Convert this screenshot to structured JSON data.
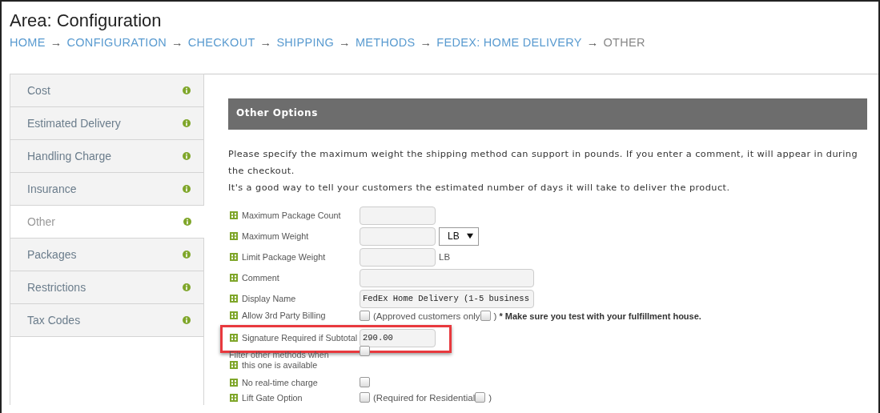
{
  "page": {
    "title": "Area: Configuration"
  },
  "breadcrumb": [
    {
      "label": "HOME",
      "current": false
    },
    {
      "label": "CONFIGURATION",
      "current": false
    },
    {
      "label": "CHECKOUT",
      "current": false
    },
    {
      "label": "SHIPPING",
      "current": false
    },
    {
      "label": "METHODS",
      "current": false
    },
    {
      "label": "FEDEX: HOME DELIVERY",
      "current": false
    },
    {
      "label": "OTHER",
      "current": true
    }
  ],
  "breadcrumb_separator": "→",
  "sidebar": {
    "items": [
      {
        "label": "Cost",
        "selected": false
      },
      {
        "label": "Estimated Delivery",
        "selected": false
      },
      {
        "label": "Handling Charge",
        "selected": false
      },
      {
        "label": "Insurance",
        "selected": false
      },
      {
        "label": "Other",
        "selected": true
      },
      {
        "label": "Packages",
        "selected": false
      },
      {
        "label": "Restrictions",
        "selected": false
      },
      {
        "label": "Tax Codes",
        "selected": false
      }
    ]
  },
  "section": {
    "title": "Other Options",
    "description": [
      "Please specify the maximum weight the shipping method can support in pounds. If you enter a comment, it will appear in during the checkout.",
      "It's a good way to tell your customers the estimated number of days it will take to deliver the product."
    ]
  },
  "form_rows": [
    {
      "label": "Maximum Package Count",
      "highlighted": false,
      "controls": [
        {
          "kind": "input"
        }
      ]
    },
    {
      "label": "Maximum Weight",
      "highlighted": false,
      "controls": [
        {
          "kind": "input"
        },
        {
          "kind": "select",
          "value": "LB"
        }
      ]
    },
    {
      "label": "Limit Package Weight",
      "highlighted": false,
      "controls": [
        {
          "kind": "input"
        },
        {
          "kind": "text",
          "text": "LB"
        }
      ]
    },
    {
      "label": "Comment",
      "highlighted": false,
      "controls": [
        {
          "kind": "wide_input"
        }
      ]
    },
    {
      "label": "Display Name",
      "highlighted": false,
      "controls": [
        {
          "kind": "wide_input",
          "value": "FedEx Home Delivery (1-5 business"
        }
      ]
    },
    {
      "label": "Allow 3rd Party Billing",
      "highlighted": false,
      "controls": [
        {
          "kind": "checkbox",
          "checked": false
        },
        {
          "kind": "text",
          "text": "(Approved customers only"
        },
        {
          "kind": "checkbox",
          "checked": false
        },
        {
          "kind": "text",
          "text": ")"
        },
        {
          "kind": "note",
          "text": "* Make sure you test with your fulfillment house."
        }
      ]
    },
    {
      "label": "Signature Required if Subtotal",
      "highlighted": true,
      "controls": [
        {
          "kind": "input",
          "value": "290.00"
        }
      ]
    },
    {
      "label_lead": "Filter other methods when",
      "label": "this one is available",
      "highlighted": false,
      "controls": [
        {
          "kind": "checkbox",
          "checked": false
        }
      ]
    },
    {
      "label": "No real-time charge",
      "highlighted": false,
      "controls": [
        {
          "kind": "checkbox",
          "checked": false
        }
      ]
    },
    {
      "label": "Lift Gate Option",
      "highlighted": false,
      "controls": [
        {
          "kind": "checkbox",
          "checked": false
        },
        {
          "kind": "text",
          "text": "(Required for Residential"
        },
        {
          "kind": "checkbox",
          "checked": false
        },
        {
          "kind": "text",
          "text": ")"
        }
      ]
    }
  ]
}
